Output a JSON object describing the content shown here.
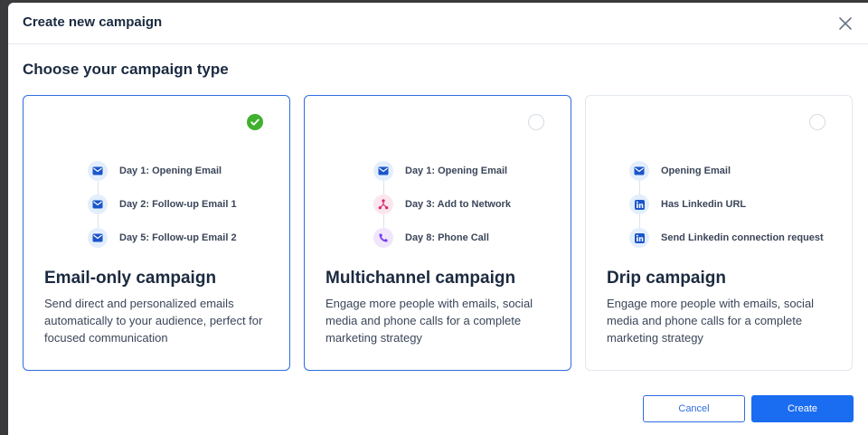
{
  "modal": {
    "title": "Create new campaign",
    "close_icon": "close-icon"
  },
  "section_title": "Choose your campaign type",
  "cards": [
    {
      "title": "Email-only campaign",
      "description": "Send direct and personalized emails automatically to your audience, perfect for focused communication",
      "selected": true,
      "steps": [
        {
          "label": "Day 1: Opening Email",
          "icon": "mail-icon"
        },
        {
          "label": "Day 2: Follow-up Email 1",
          "icon": "mail-icon"
        },
        {
          "label": "Day 5: Follow-up Email 2",
          "icon": "mail-icon"
        }
      ]
    },
    {
      "title": "Multichannel campaign",
      "description": "Engage more people with emails, social media and phone calls for a complete marketing strategy",
      "selected": false,
      "steps": [
        {
          "label": "Day 1: Opening Email",
          "icon": "mail-icon"
        },
        {
          "label": "Day 3: Add to Network",
          "icon": "network-icon"
        },
        {
          "label": "Day 8: Phone Call",
          "icon": "phone-icon"
        }
      ]
    },
    {
      "title": "Drip campaign",
      "description": "Engage more people with emails, social media and phone calls for a complete marketing strategy",
      "selected": false,
      "steps": [
        {
          "label": "Opening Email",
          "icon": "mail-icon"
        },
        {
          "label": "Has Linkedin URL",
          "icon": "linkedin-icon"
        },
        {
          "label": "Send Linkedin connection request",
          "icon": "linkedin-icon"
        }
      ]
    }
  ],
  "footer": {
    "cancel_label": "Cancel",
    "create_label": "Create"
  },
  "colors": {
    "primary": "#1a6cf0",
    "selected_border": "#2f6de1",
    "check_green": "#3fb12e",
    "network_pink": "#e0226e",
    "phone_purple": "#7a3cf0"
  }
}
